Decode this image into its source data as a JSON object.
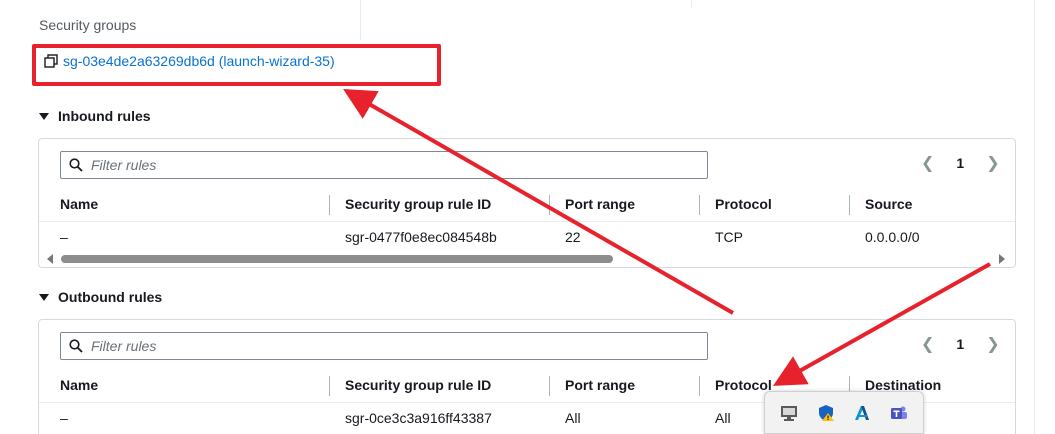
{
  "security_groups": {
    "label": "Security groups",
    "link_text": "sg-03e4de2a63269db6d (launch-wizard-35)"
  },
  "inbound": {
    "title": "Inbound rules",
    "filter_placeholder": "Filter rules",
    "page": "1",
    "columns": [
      "Name",
      "Security group rule ID",
      "Port range",
      "Protocol",
      "Source"
    ],
    "rows": [
      {
        "name": "–",
        "rule_id": "sgr-0477f0e8ec084548b",
        "port_range": "22",
        "protocol": "TCP",
        "source": "0.0.0.0/0"
      }
    ]
  },
  "outbound": {
    "title": "Outbound rules",
    "filter_placeholder": "Filter rules",
    "page": "1",
    "columns": [
      "Name",
      "Security group rule ID",
      "Port range",
      "Protocol",
      "Destination"
    ],
    "rows": [
      {
        "name": "–",
        "rule_id": "sgr-0ce3c3a916ff43387",
        "port_range": "All",
        "protocol": "All"
      }
    ]
  },
  "colors": {
    "link": "#0972d3",
    "annotation_red": "#e8222c",
    "border": "#d5dbdb"
  },
  "icons": {
    "copy": "copy-icon",
    "search": "search-icon",
    "tray": [
      "display-icon",
      "defender-shield-icon",
      "autodesk-icon",
      "teams-icon"
    ]
  }
}
